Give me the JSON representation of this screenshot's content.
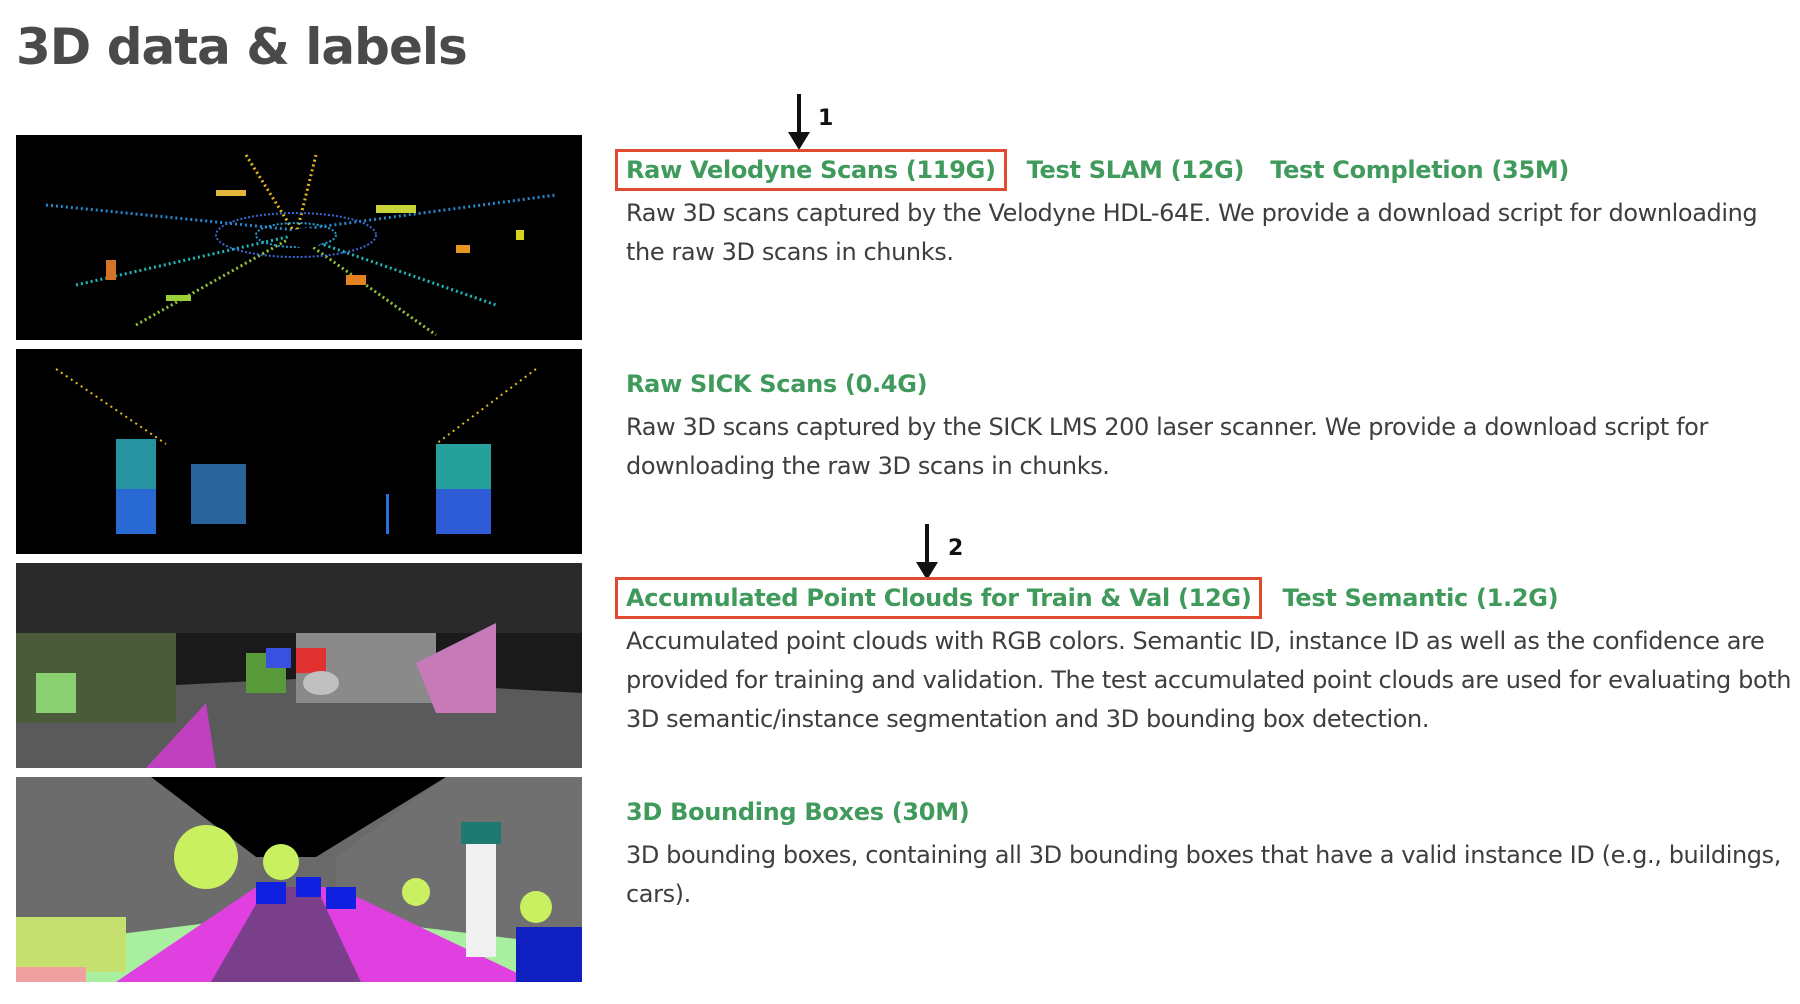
{
  "page": {
    "title": "3D data & labels"
  },
  "sections": [
    {
      "links": [
        "Raw Velodyne Scans (119G)",
        "Test SLAM (12G)",
        "Test Completion (35M)"
      ],
      "description": "Raw 3D scans captured by the Velodyne HDL-64E. We provide a download script for downloading the raw 3D scans in chunks.",
      "highlighted_link": "Raw Velodyne Scans (119G)"
    },
    {
      "links": [
        "Raw SICK Scans (0.4G)"
      ],
      "description": "Raw 3D scans captured by the SICK LMS 200 laser scanner. We provide a download script for downloading the raw 3D scans in chunks."
    },
    {
      "links": [
        "Accumulated Point Clouds for Train & Val (12G)",
        "Test Semantic (1.2G)"
      ],
      "description": "Accumulated point clouds with RGB colors. Semantic ID, instance ID as well as the confidence are provided for training and validation. The test accumulated point clouds are used for evaluating both 3D semantic/instance segmentation and 3D bounding box detection.",
      "highlighted_link": "Accumulated Point Clouds for Train & Val (12G)"
    },
    {
      "links": [
        "3D Bounding Boxes (30M)"
      ],
      "description": "3D bounding boxes, containing all 3D bounding boxes that have a valid instance ID (e.g., buildings, cars)."
    }
  ],
  "annotations": [
    {
      "label": "1"
    },
    {
      "label": "2"
    }
  ],
  "colors": {
    "link": "#3f9a5c",
    "highlight_box": "#e04a2e",
    "text": "#3e3e3e",
    "title": "#4a4a4a"
  },
  "icons": [
    "down-arrow-icon",
    "down-arrow-icon"
  ]
}
